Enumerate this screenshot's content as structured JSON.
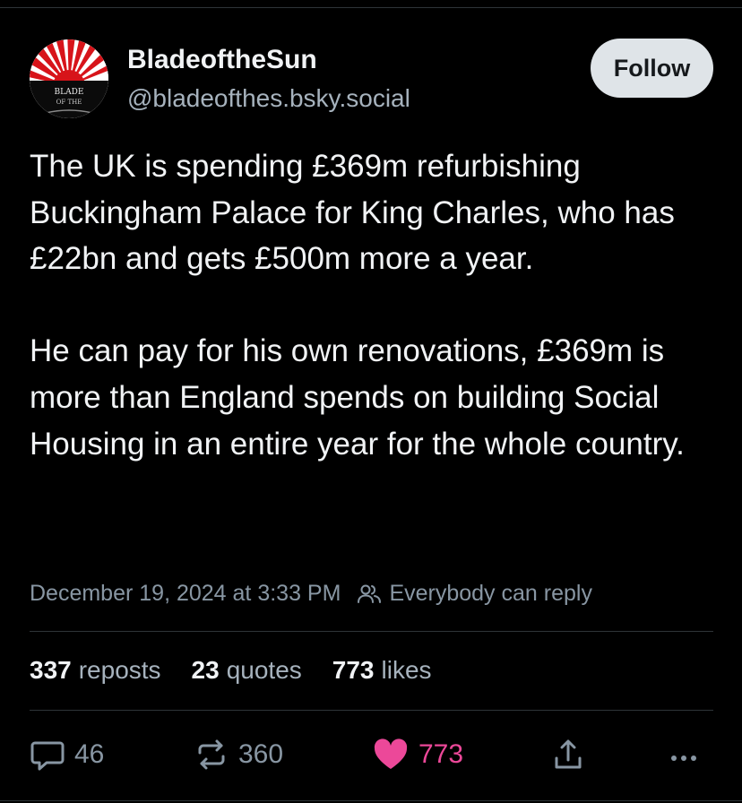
{
  "author": {
    "display_name": "BladeoftheSun",
    "handle": "@bladeofthes.bsky.social",
    "avatar_icon": "rising-sun-avatar",
    "avatar_text": [
      "BLADE",
      "OF THE"
    ]
  },
  "follow_label": "Follow",
  "post": {
    "paragraphs": [
      "The UK is spending £369m refurbishing Buckingham Palace for King Charles, who has £22bn and gets £500m more a year.",
      "He can pay for his own renovations, £369m is more than England spends on building Social Housing in an entire year for the whole country."
    ]
  },
  "meta": {
    "timestamp": "December 19, 2024 at 3:33 PM",
    "reply_setting": "Everybody can reply",
    "reply_icon": "people-icon"
  },
  "stats": {
    "reposts": {
      "count": "337",
      "label": "reposts"
    },
    "quotes": {
      "count": "23",
      "label": "quotes"
    },
    "likes": {
      "count": "773",
      "label": "likes"
    }
  },
  "actions": {
    "reply": {
      "icon": "reply-bubble-icon",
      "count": "46"
    },
    "repost": {
      "icon": "repost-icon",
      "count": "360"
    },
    "like": {
      "icon": "heart-icon",
      "count": "773",
      "liked": true
    },
    "share": {
      "icon": "share-icon"
    },
    "more": {
      "icon": "more-icon"
    }
  },
  "colors": {
    "background": "#000000",
    "text": "#f1f3f5",
    "muted": "#8896a3",
    "like": "#ec4899",
    "follow_bg": "#dfe4e8"
  }
}
